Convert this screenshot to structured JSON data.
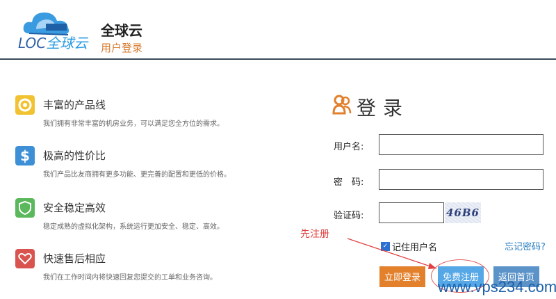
{
  "header": {
    "logo_text_latin": "LOC",
    "logo_text_cn": "全球云",
    "title": "全球云",
    "subtitle": "用户登录"
  },
  "features": [
    {
      "icon": "lifebuoy-icon",
      "color": "#f1c232",
      "title": "丰富的产品线",
      "desc": "我们拥有非常丰富的机房业务，可以满足您全方位的需求。"
    },
    {
      "icon": "dollar-icon",
      "color": "#3d8fd6",
      "title": "极高的性价比",
      "desc": "我们产品比友商拥有更多功能、更完善的配置和更低的价格。"
    },
    {
      "icon": "shield-icon",
      "color": "#5cb85c",
      "title": "安全稳定高效",
      "desc": "稳定成熟的虚拟化架构，系统运行更加安全、稳定、高效。"
    },
    {
      "icon": "heart-icon",
      "color": "#d9534f",
      "title": "快速售后相应",
      "desc": "我们在工作时间内将快速回复您提交的工单和业务咨询。"
    }
  ],
  "login": {
    "title": "登录",
    "username_label": "用户名:",
    "username_value": "",
    "password_label": "密　码:",
    "password_value": "",
    "captcha_label": "验证码:",
    "captcha_value": "",
    "captcha_image_text": "46B6",
    "remember_label": "记住用户名",
    "remember_checked": true,
    "forgot_link": "忘记密码?",
    "login_button": "立即登录",
    "register_button": "免费注册",
    "home_button": "返回首页"
  },
  "annotation": {
    "text": "先注册",
    "color": "#e04040"
  },
  "watermark": "www.vps234.com",
  "colors": {
    "accent_orange": "#e2802c",
    "link_blue": "#2a7fc1",
    "header_line": "#3b4a5a"
  }
}
